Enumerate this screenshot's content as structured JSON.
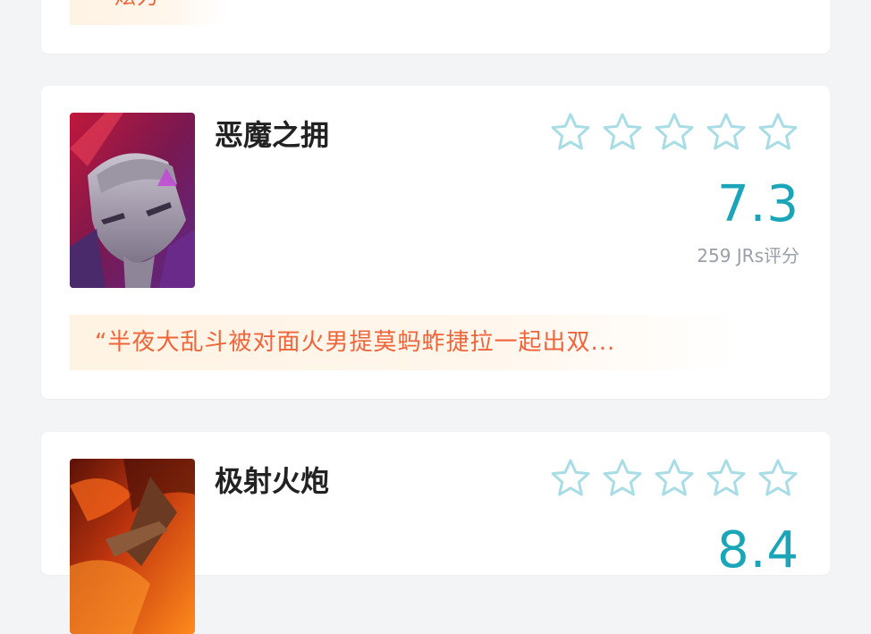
{
  "cards": [
    {
      "quote_tail": "炫力"
    },
    {
      "title": "恶魔之拥",
      "score": "7.3",
      "rating_count": "259 JRs评分",
      "quote": "“半夜大乱斗被对面火男提莫蚂蚱捷拉一起出双...",
      "stars_total": 5,
      "stars_filled": 0
    },
    {
      "title": "极射火炮",
      "score": "8.4",
      "stars_total": 5,
      "stars_filled": 0
    }
  ],
  "colors": {
    "accent": "#1aa5b8",
    "quote_text": "#f0643a",
    "quote_bg": "#fff3e3"
  },
  "icons": [
    "star-outline-icon"
  ]
}
